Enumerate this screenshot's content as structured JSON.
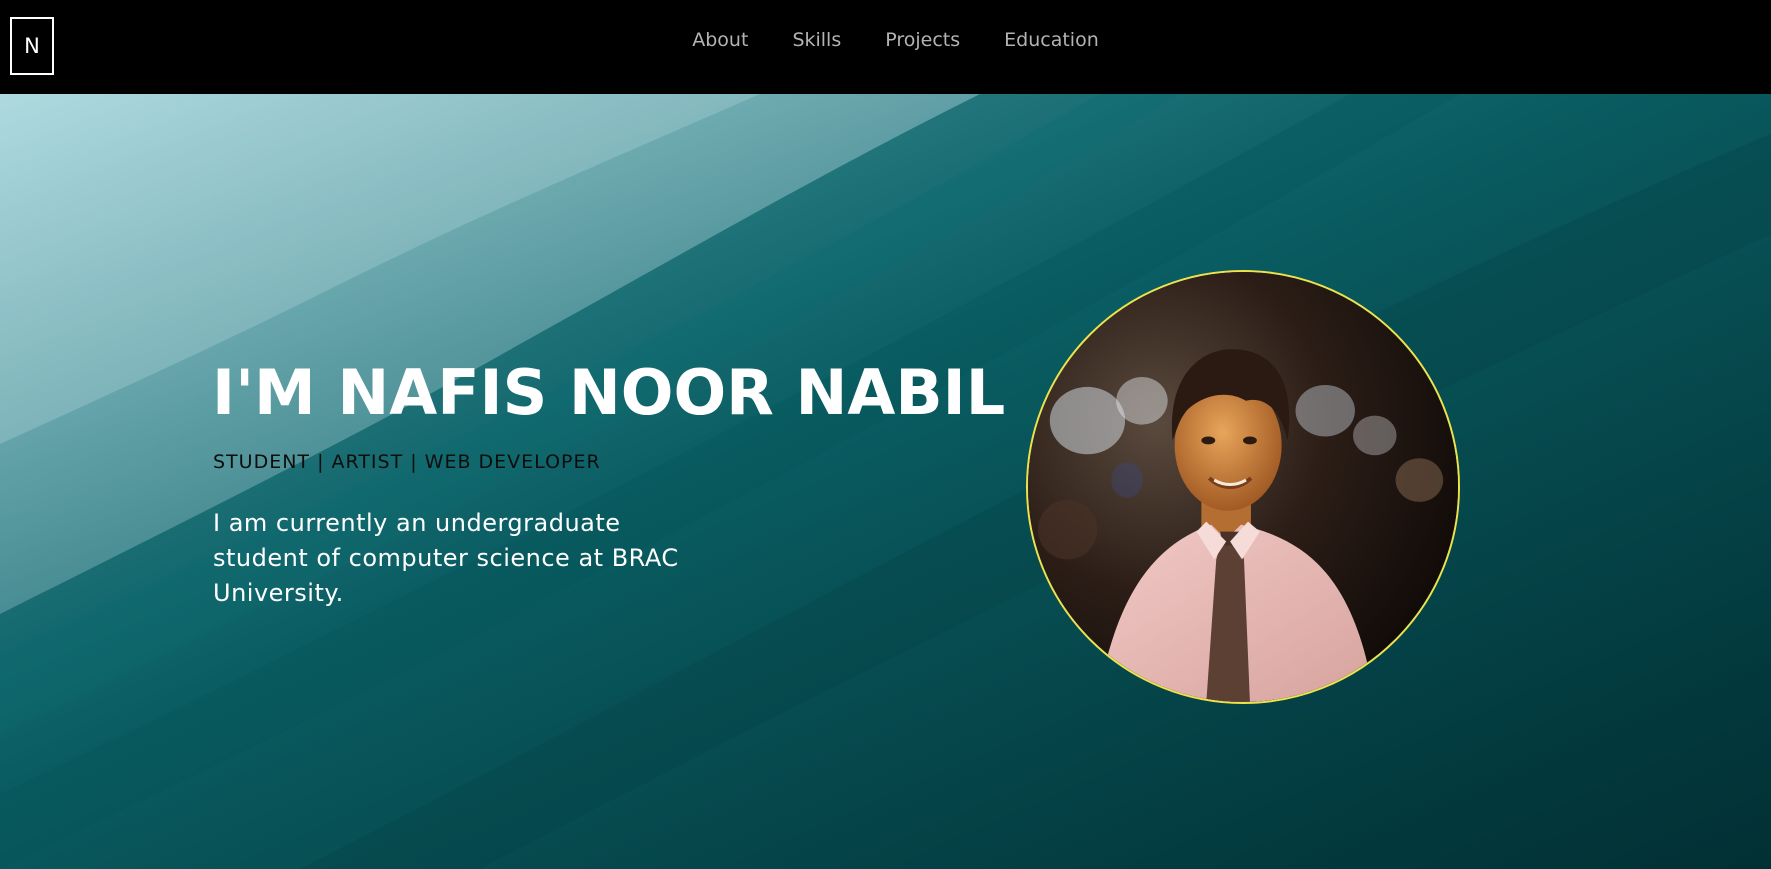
{
  "header": {
    "logo_text": "N",
    "nav": [
      {
        "label": "About"
      },
      {
        "label": "Skills"
      },
      {
        "label": "Projects"
      },
      {
        "label": "Education"
      }
    ]
  },
  "hero": {
    "title": "I'M NAFIS NOOR NABIL",
    "subtitle": "STUDENT | ARTIST | WEB DEVELOPER",
    "description": "I am currently an undergraduate student of computer science at BRAC University."
  },
  "colors": {
    "navbar": "#000000",
    "nav_text": "#b3b3b3",
    "teal_dark": "#03484d",
    "teal_light": "#8cc7d0",
    "photo_border": "#f0e24a"
  }
}
